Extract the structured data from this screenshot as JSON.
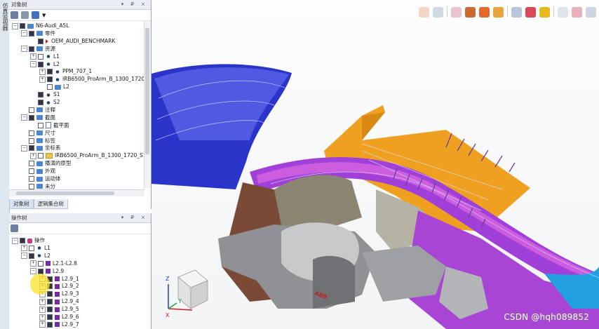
{
  "side_tab": {
    "label": "仿真监视器"
  },
  "object_tree": {
    "title": "对象树",
    "title_buttons": "▾ ₽ ×",
    "rows": [
      {
        "depth": 0,
        "exp": "−",
        "chk": true,
        "icon": "folder",
        "label": "N6-Audi_A5L"
      },
      {
        "depth": 1,
        "exp": "−",
        "chk": true,
        "icon": "folder",
        "label": "零件"
      },
      {
        "depth": 2,
        "exp": "",
        "chk": true,
        "icon": "part-triangle",
        "label": "OEM_AUDI_BENCHMARK"
      },
      {
        "depth": 1,
        "exp": "−",
        "chk": true,
        "icon": "folder",
        "label": "资源"
      },
      {
        "depth": 2,
        "exp": "+",
        "chk": false,
        "icon": "resource",
        "label": "L1"
      },
      {
        "depth": 2,
        "exp": "−",
        "chk": true,
        "icon": "resource",
        "label": "L2"
      },
      {
        "depth": 3,
        "exp": "+",
        "chk": true,
        "icon": "resource",
        "label": "PPM_707_1"
      },
      {
        "depth": 3,
        "exp": "+",
        "chk": true,
        "icon": "robot",
        "label": "IRB6500_ProArm_B_1300_1720"
      },
      {
        "depth": 3,
        "exp": "",
        "chk": false,
        "icon": "folder",
        "label": "L2"
      },
      {
        "depth": 2,
        "exp": "",
        "chk": true,
        "icon": "resource",
        "label": "S1"
      },
      {
        "depth": 2,
        "exp": "",
        "chk": true,
        "icon": "resource",
        "label": "S2"
      },
      {
        "depth": 1,
        "exp": "",
        "chk": false,
        "icon": "folder",
        "label": "注释"
      },
      {
        "depth": 1,
        "exp": "−",
        "chk": true,
        "icon": "folder",
        "label": "截面"
      },
      {
        "depth": 2,
        "exp": "",
        "chk": false,
        "icon": "plane",
        "label": "截平面"
      },
      {
        "depth": 1,
        "exp": "",
        "chk": false,
        "icon": "folder",
        "label": "尺寸"
      },
      {
        "depth": 1,
        "exp": "",
        "chk": false,
        "icon": "folder",
        "label": "标签"
      },
      {
        "depth": 1,
        "exp": "−",
        "chk": true,
        "icon": "folder",
        "label": "坐标系"
      },
      {
        "depth": 2,
        "exp": "+",
        "chk": false,
        "icon": "folder-yellow",
        "label": "IRB6500_ProArm_B_1300_1720_S1"
      },
      {
        "depth": 1,
        "exp": "",
        "chk": false,
        "icon": "folder",
        "label": "播演的原型"
      },
      {
        "depth": 1,
        "exp": "",
        "chk": false,
        "icon": "folder",
        "label": "外观"
      },
      {
        "depth": 1,
        "exp": "",
        "chk": false,
        "icon": "folder",
        "label": "运动体"
      },
      {
        "depth": 1,
        "exp": "",
        "chk": false,
        "icon": "folder",
        "label": "未分"
      }
    ],
    "tabs": [
      "对象树",
      "逻辑集合树"
    ]
  },
  "operation_tree": {
    "title": "操作树",
    "title_buttons": "▾ ₽ ×",
    "rows": [
      {
        "depth": 0,
        "exp": "−",
        "chk": true,
        "icon": "operation",
        "label": "操作"
      },
      {
        "depth": 1,
        "exp": "+",
        "chk": false,
        "icon": "resource",
        "label": "L1"
      },
      {
        "depth": 1,
        "exp": "−",
        "chk": true,
        "icon": "resource",
        "label": "L2"
      },
      {
        "depth": 2,
        "exp": "+",
        "chk": false,
        "icon": "paint-op",
        "label": "L2.1-L2.8"
      },
      {
        "depth": 2,
        "exp": "−",
        "chk": true,
        "icon": "paint-op",
        "label": "L2.9"
      },
      {
        "depth": 3,
        "exp": "+",
        "chk": true,
        "icon": "paint-op",
        "label": "L2.9_1"
      },
      {
        "depth": 3,
        "exp": "+",
        "chk": true,
        "icon": "paint-op",
        "label": "L2.9_2"
      },
      {
        "depth": 3,
        "exp": "+",
        "chk": true,
        "icon": "paint-op",
        "label": "L2.9_3"
      },
      {
        "depth": 3,
        "exp": "+",
        "chk": true,
        "icon": "paint-op",
        "label": "L2.9_4"
      },
      {
        "depth": 3,
        "exp": "+",
        "chk": true,
        "icon": "paint-op",
        "label": "L2.9_5"
      },
      {
        "depth": 3,
        "exp": "+",
        "chk": true,
        "icon": "paint-op",
        "label": "L2.9_6"
      },
      {
        "depth": 3,
        "exp": "+",
        "chk": true,
        "icon": "paint-op",
        "label": "L2.9_7"
      }
    ]
  },
  "viewport": {
    "toolbar_icons": [
      "zoom-in-icon",
      "zoom-fit-icon",
      "snap-icon",
      "view-cube-icon",
      "shading-icon",
      "light-icon",
      "select-icon",
      "pick-level-icon",
      "filter-icon",
      "placement-icon",
      "relocate-icon",
      "measure-icon"
    ],
    "robot_brand": "ABB",
    "watermark": "CSDN @hqh089852",
    "axis_labels": {
      "x": "X",
      "y": "Y",
      "z": "Z"
    }
  }
}
